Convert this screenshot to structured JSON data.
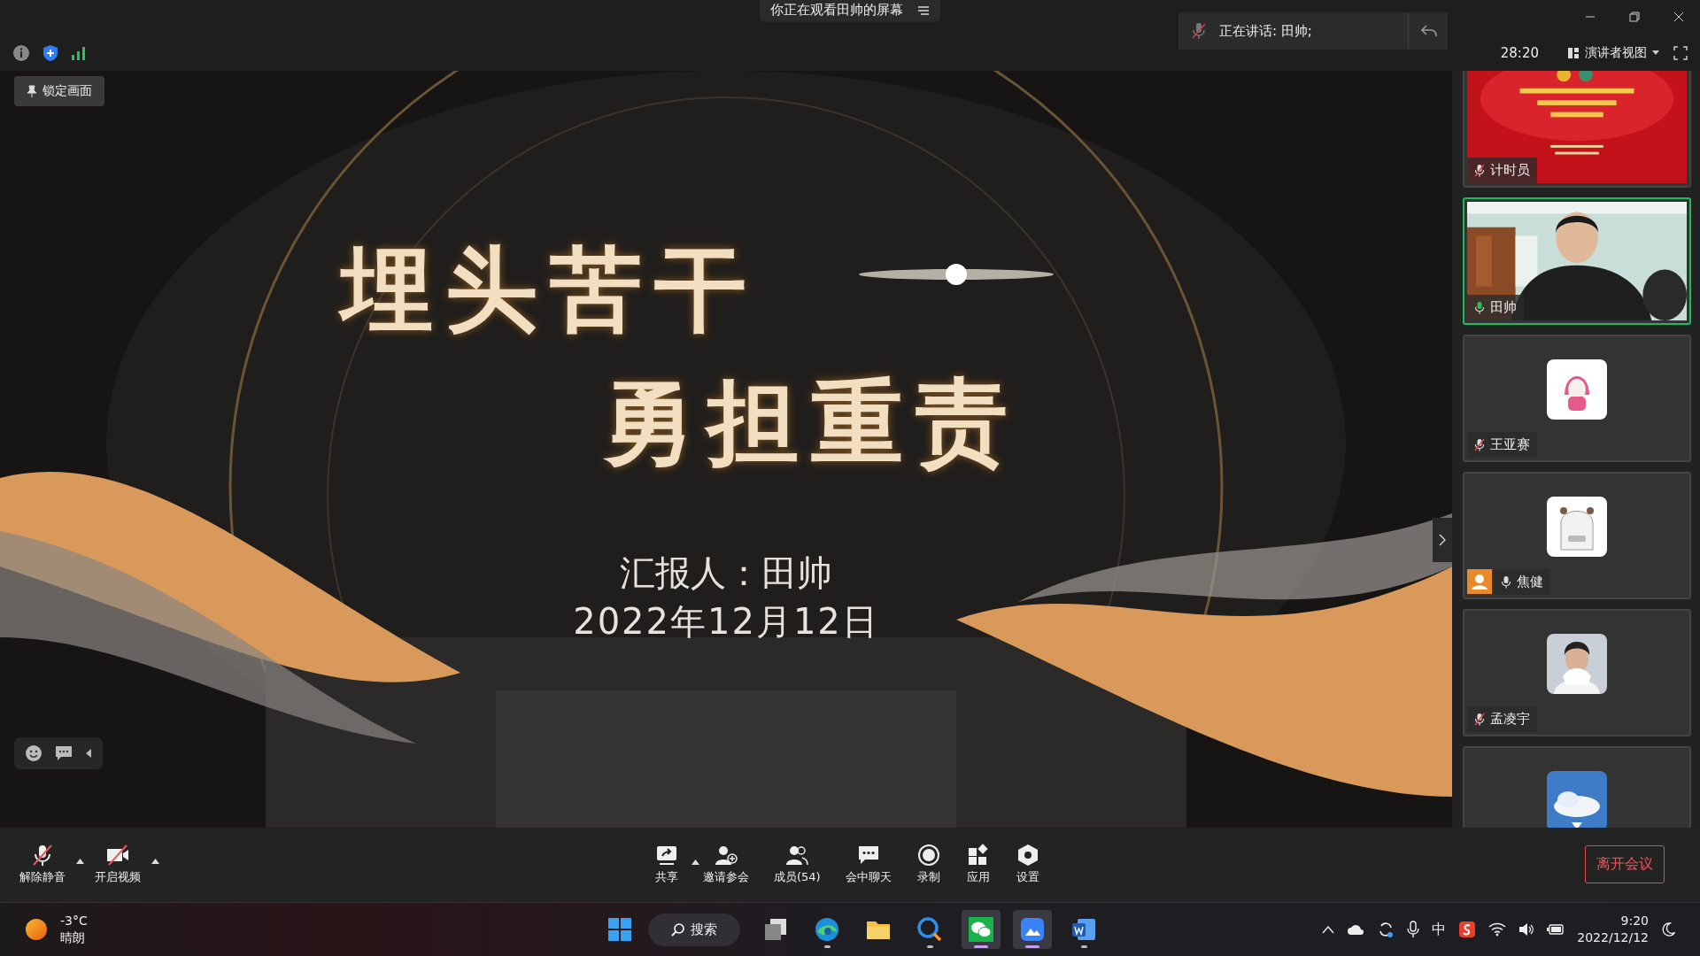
{
  "title_bar": {
    "banner": "你正在观看田帅的屏幕"
  },
  "speaking": {
    "label": "正在讲话: 田帅;"
  },
  "top_bar": {
    "timer": "28:20",
    "view": "演讲者视图"
  },
  "lock_button": "锁定画面",
  "slide": {
    "lines": [
      "埋头苦干",
      "勇担重责"
    ],
    "reporter": "汇报人：田帅",
    "date": "2022年12月12日"
  },
  "participants": [
    {
      "kind": "screen",
      "name": "计时员",
      "muted": true,
      "selected": false,
      "host": false
    },
    {
      "kind": "camera",
      "name": "田帅",
      "muted": false,
      "selected": true,
      "host": false
    },
    {
      "kind": "avatar",
      "name": "王亚赛",
      "muted": true,
      "selected": false,
      "host": false
    },
    {
      "kind": "avatar",
      "name": "焦健",
      "muted": false,
      "selected": false,
      "host": true
    },
    {
      "kind": "avatar",
      "name": "孟凌宇",
      "muted": true,
      "selected": false,
      "host": false
    },
    {
      "kind": "avatar",
      "selected": false
    }
  ],
  "controls": {
    "left": [
      {
        "kind": "mic",
        "label": "解除静音",
        "off": true
      },
      {
        "kind": "camera",
        "label": "开启视频",
        "off": true
      }
    ],
    "center": [
      {
        "kind": "share",
        "label": "共享",
        "menu": true
      },
      {
        "kind": "invite",
        "label": "邀请参会",
        "menu": false
      },
      {
        "kind": "members",
        "label": "成员(54)",
        "menu": false
      },
      {
        "kind": "chat",
        "label": "会中聊天",
        "menu": false
      },
      {
        "kind": "record",
        "label": "录制",
        "menu": false
      },
      {
        "kind": "apps",
        "label": "应用",
        "menu": false
      },
      {
        "kind": "settings",
        "label": "设置",
        "menu": false
      }
    ],
    "leave": "离开会议"
  },
  "taskbar": {
    "weather": {
      "temp": "-3°C",
      "condition": "晴朗"
    },
    "search": "搜索",
    "apps": [
      {
        "kind": "taskview",
        "running": false,
        "active": false
      },
      {
        "kind": "edge",
        "running": true,
        "active": false
      },
      {
        "kind": "folder",
        "running": false,
        "active": false
      },
      {
        "kind": "finder",
        "running": true,
        "active": false
      },
      {
        "kind": "chat",
        "running": true,
        "active": true
      },
      {
        "kind": "meeting",
        "running": true,
        "active": true
      },
      {
        "kind": "word",
        "running": true,
        "active": false
      }
    ],
    "ime": "中",
    "time": "9:20",
    "date": "2022/12/12"
  }
}
